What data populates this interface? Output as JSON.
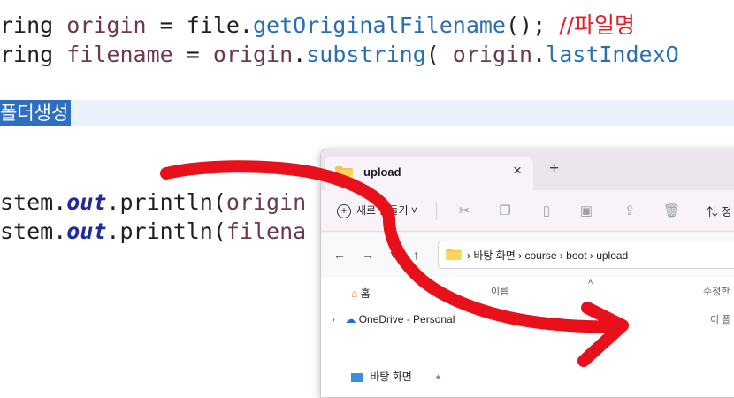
{
  "code": {
    "line1": {
      "pre": "ring ",
      "var": "origin",
      "mid": " = file.",
      "fn": "getOriginalFilename",
      "post": "(); ",
      "comment": "//파일명"
    },
    "line2": {
      "pre": "ring ",
      "var": "filename",
      "mid": " = ",
      "var2": "origin",
      "mid2": ".",
      "fn": "substring",
      "post": "( ",
      "var3": "origin",
      "mid3": ".",
      "fn2": "lastIndexO"
    },
    "selection": "폴더생성",
    "line3": {
      "pre": "stem.",
      "out": "out",
      "mid": ".",
      "fn": "println",
      "post": "(",
      "arg": "origin"
    },
    "line4": {
      "pre": "stem.",
      "out": "out",
      "mid": ".",
      "fn": "println",
      "post": "(",
      "arg": "filena"
    }
  },
  "explorer": {
    "tab_title": "upload",
    "tab_close": "×",
    "tab_new": "+",
    "new_button": "새로 만들기 ˅",
    "sort_label": "⇅ 정",
    "nav_back": "←",
    "nav_forward": "→",
    "nav_down": "˅",
    "nav_up": "↑",
    "address": "›  바탕 화면  ›  course  ›  boot  ›  upload",
    "sidebar": {
      "home": "홈",
      "onedrive": "OneDrive - Personal",
      "desktop": "바탕 화면",
      "chevron": "›"
    },
    "columns": {
      "name": "이름",
      "modified": "수정한"
    },
    "sort_caret": "^",
    "empty_message": "이 폴",
    "pin": "📌"
  },
  "colors": {
    "arrow": "#e8101a",
    "selection": "#2f6fbf",
    "folder": "#f5c44d"
  }
}
